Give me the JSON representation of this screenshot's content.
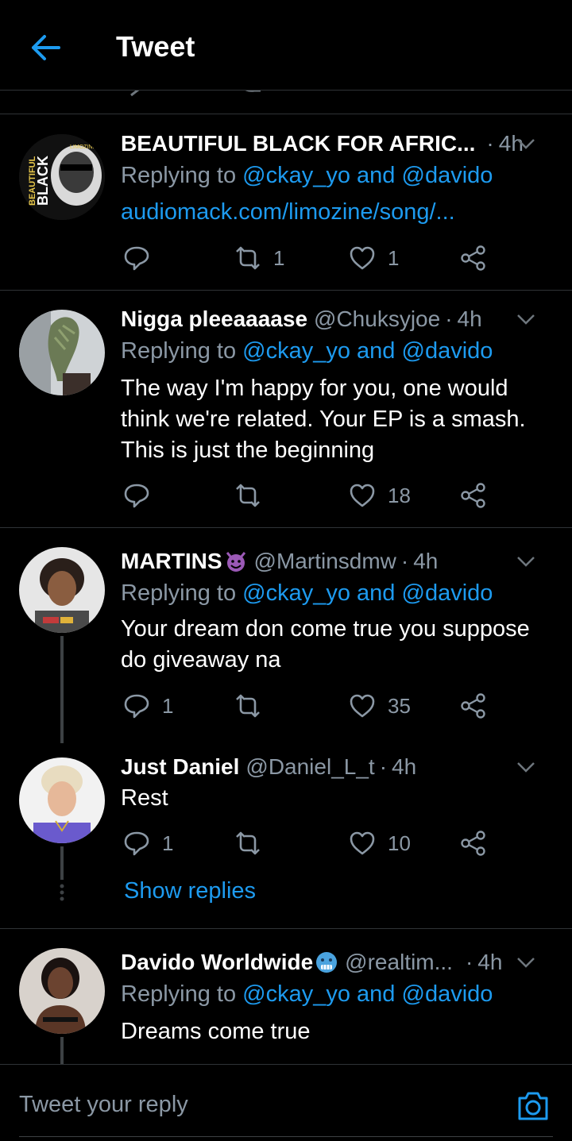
{
  "header": {
    "title": "Tweet"
  },
  "colors": {
    "accent": "#1d9bf0",
    "secondary_text": "#8b98a5",
    "background": "#000000",
    "divider": "#2f3336"
  },
  "tweets": [
    {
      "name": "BEAUTIFUL BLACK FOR AFRIC...",
      "handle": "",
      "time": "4h",
      "replying_prefix": "Replying to",
      "replying_users": [
        "@ckay_yo",
        "@davido"
      ],
      "replying_and": "and",
      "text": "",
      "link": "audiomack.com/limozine/song/...",
      "replies": "",
      "retweets": "1",
      "likes": "1"
    },
    {
      "name": "Nigga pleeaaaase",
      "handle": "@Chuksyjoe",
      "time": "4h",
      "replying_prefix": "Replying to",
      "replying_users": [
        "@ckay_yo",
        "@davido"
      ],
      "replying_and": "and",
      "text": "The way I'm happy for you, one would think we're related. Your EP is a smash. This is just the beginning",
      "replies": "",
      "retweets": "",
      "likes": "18"
    },
    {
      "name": "MARTINS",
      "name_emoji": "smiling-devil-emoji",
      "handle": "@Martinsdmw",
      "time": "4h",
      "replying_prefix": "Replying to",
      "replying_users": [
        "@ckay_yo",
        "@davido"
      ],
      "replying_and": "and",
      "text": "Your dream don come true you suppose do giveaway na",
      "replies": "1",
      "retweets": "",
      "likes": "35"
    },
    {
      "name": "Just Daniel",
      "handle": "@Daniel_L_t",
      "time": "4h",
      "text": "Rest",
      "replies": "1",
      "retweets": "",
      "likes": "10"
    },
    {
      "name": "Davido Worldwide",
      "name_emoji": "cold-face-emoji",
      "handle": "@realtim...",
      "time": "4h",
      "replying_prefix": "Replying to",
      "replying_users": [
        "@ckay_yo",
        "@davido"
      ],
      "replying_and": "and",
      "text": "Dreams come true"
    }
  ],
  "show_replies": "Show replies",
  "reply_bar": {
    "placeholder": "Tweet your reply"
  },
  "separator": "·",
  "avatar_texts": {
    "brand_small": "LIMOZINE",
    "brand_big": "BLACK",
    "brand_side": "BEAUTIFUL"
  }
}
